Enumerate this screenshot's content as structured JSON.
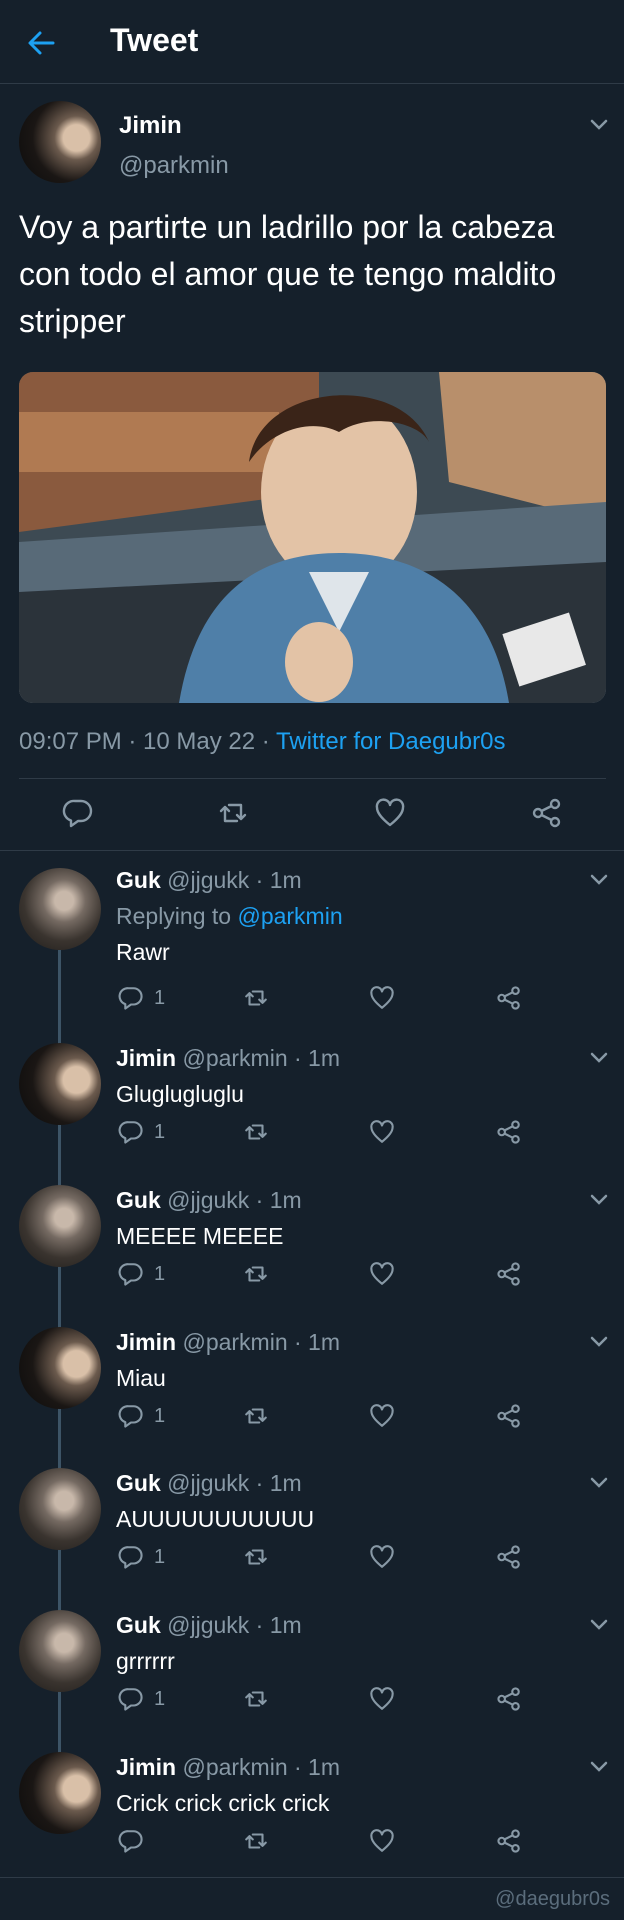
{
  "header": {
    "title": "Tweet"
  },
  "main_tweet": {
    "name": "Jimin",
    "handle": "@parkmin",
    "text": "Voy a partirte un ladrillo por la cabeza con todo el amor que te tengo maldito stripper",
    "time": "09:07 PM · 10 May 22 · ",
    "source": "Twitter for Daegubr0s"
  },
  "replies": [
    {
      "name": "Guk",
      "meta": " @jjgukk · 1m",
      "replying_prefix": "Replying to ",
      "replying_handle": "@parkmin",
      "text": "Rawr",
      "reply_count": "1",
      "avatar": "guk"
    },
    {
      "name": "Jimin",
      "meta": " @parkmin · 1m",
      "text": "Gluglugluglu",
      "reply_count": "1",
      "avatar": "jimin"
    },
    {
      "name": "Guk",
      "meta": " @jjgukk · 1m",
      "text": "MEEEE MEEEE",
      "reply_count": "1",
      "avatar": "guk"
    },
    {
      "name": "Jimin",
      "meta": " @parkmin · 1m",
      "text": "Miau",
      "reply_count": "1",
      "avatar": "jimin"
    },
    {
      "name": "Guk",
      "meta": " @jjgukk · 1m",
      "text": "AUUUUUUUUUUU",
      "reply_count": "1",
      "avatar": "guk"
    },
    {
      "name": "Guk",
      "meta": " @jjgukk · 1m",
      "text": "grrrrrr",
      "reply_count": "1",
      "avatar": "guk"
    },
    {
      "name": "Jimin",
      "meta": " @parkmin · 1m",
      "text": "Crick crick crick crick",
      "reply_count": "",
      "avatar": "jimin"
    }
  ],
  "icons": {
    "back": "back-arrow-icon",
    "more": "chevron-down-icon",
    "reply": "reply-icon",
    "retweet": "retweet-icon",
    "like": "heart-icon",
    "share": "share-icon"
  },
  "colors": {
    "background": "#15202b",
    "accent": "#1da1f2",
    "muted": "#8899a6"
  },
  "watermark": "@daegubr0s"
}
